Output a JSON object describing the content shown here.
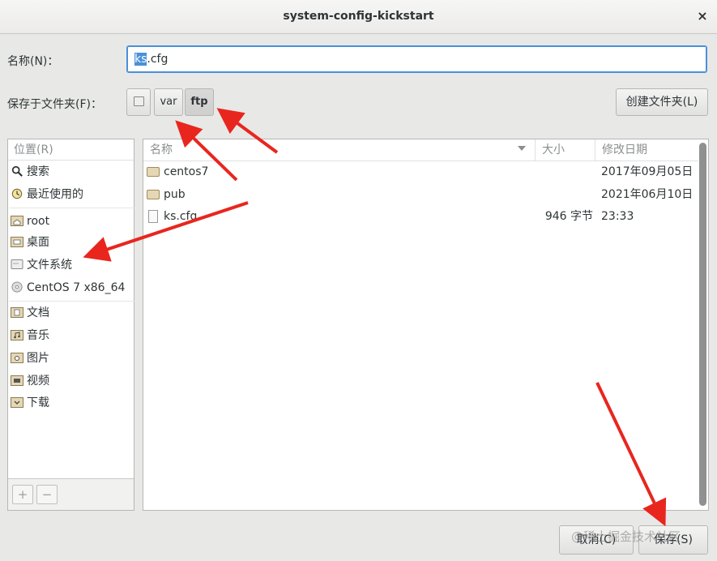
{
  "window": {
    "title": "system-config-kickstart",
    "close_glyph": "×"
  },
  "name_field": {
    "label": "名称(N)：",
    "value_selected": "ks",
    "value_rest": ".cfg"
  },
  "folder_field": {
    "label": "保存于文件夹(F)：",
    "path": [
      {
        "label": "",
        "icon": "disk-icon"
      },
      {
        "label": "var"
      },
      {
        "label": "ftp",
        "active": true
      }
    ],
    "create_folder_label": "创建文件夹(L)"
  },
  "places": {
    "header": "位置(R)",
    "items": [
      {
        "label": "搜索",
        "icon": "search-icon"
      },
      {
        "label": "最近使用的",
        "icon": "recent-icon"
      },
      {
        "label": "root",
        "icon": "home-folder-icon"
      },
      {
        "label": "桌面",
        "icon": "desktop-folder-icon"
      },
      {
        "label": "文件系统",
        "icon": "filesystem-icon"
      },
      {
        "label": "CentOS 7 x86_64",
        "icon": "optical-disc-icon"
      },
      {
        "label": "文档",
        "icon": "documents-folder-icon"
      },
      {
        "label": "音乐",
        "icon": "music-folder-icon"
      },
      {
        "label": "图片",
        "icon": "pictures-folder-icon"
      },
      {
        "label": "视频",
        "icon": "videos-folder-icon"
      },
      {
        "label": "下载",
        "icon": "downloads-folder-icon"
      }
    ],
    "add_label": "+",
    "remove_label": "−"
  },
  "files": {
    "columns": {
      "name": "名称",
      "size": "大小",
      "modified": "修改日期"
    },
    "rows": [
      {
        "name": "centos7",
        "size": "",
        "modified": "2017年09月05日",
        "type": "folder"
      },
      {
        "name": "pub",
        "size": "",
        "modified": "2021年06月10日",
        "type": "folder"
      },
      {
        "name": "ks.cfg",
        "size": "946 字节",
        "modified": "23:33",
        "type": "file"
      }
    ]
  },
  "footer": {
    "cancel_label": "取消(C)",
    "save_label": "保存(S)"
  },
  "watermark": "@稀土掘金技术社区",
  "colors": {
    "accent": "#4a90d9",
    "arrow": "#e8261e"
  }
}
